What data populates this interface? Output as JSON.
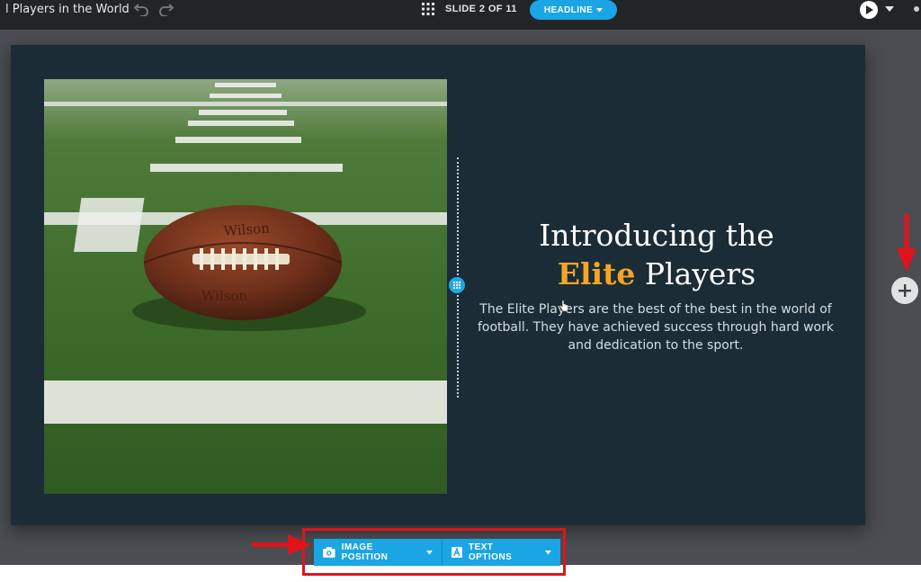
{
  "topbar": {
    "deck_title": "l Players in the World",
    "slide_counter": "SLIDE 2 OF 11",
    "headline_label": "HEADLINE"
  },
  "slide": {
    "heading_line1": "Introducing the",
    "heading_accent": "Elite",
    "heading_line2_rest": " Players",
    "body": "The Elite Players are the best of the best in the world of football. They have achieved success through hard work and dedication to the sport."
  },
  "toolbar": {
    "image_position_label": "IMAGE POSITION",
    "text_options_label": "TEXT OPTIONS"
  },
  "colors": {
    "accent": "#1aa5e4",
    "slide_bg": "#1b2c36",
    "heading_accent": "#f5a524",
    "annotation_red": "#e0131b"
  },
  "icons": [
    "undo-icon",
    "redo-icon",
    "grid-icon",
    "chevron-down-icon",
    "play-icon",
    "more-icon",
    "plus-icon",
    "camera-icon",
    "text-format-icon",
    "drag-handle-icon"
  ]
}
